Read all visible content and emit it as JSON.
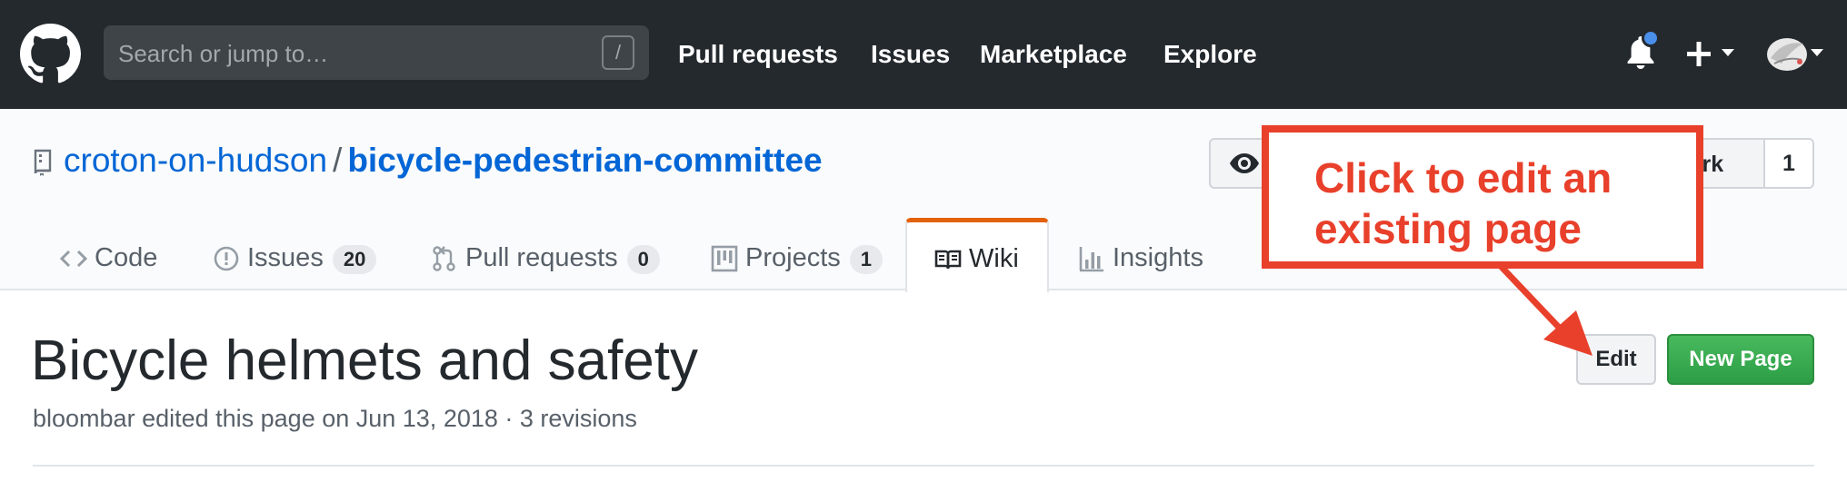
{
  "topbar": {
    "search_placeholder": "Search or jump to…",
    "search_shortcut": "/",
    "nav": [
      "Pull requests",
      "Issues",
      "Marketplace",
      "Explore"
    ]
  },
  "repo": {
    "owner": "croton-on-hudson",
    "separator": "/",
    "name": "bicycle-pedestrian-committee",
    "fork_label": "Fork",
    "fork_count": "1"
  },
  "tabs": {
    "code": {
      "label": "Code"
    },
    "issues": {
      "label": "Issues",
      "count": "20"
    },
    "pulls": {
      "label": "Pull requests",
      "count": "0"
    },
    "projects": {
      "label": "Projects",
      "count": "1"
    },
    "wiki": {
      "label": "Wiki"
    },
    "insights": {
      "label": "Insights"
    }
  },
  "wiki_page": {
    "title": "Bicycle helmets and safety",
    "meta": "bloombar edited this page on Jun 13, 2018 · 3 revisions",
    "edit_label": "Edit",
    "new_page_label": "New Page"
  },
  "annotation": {
    "text": "Click to edit an existing page",
    "color": "#e8402b"
  },
  "colors": {
    "header_bg": "#24292e",
    "link": "#0366d6",
    "green_button": "#2ea44f",
    "wiki_tab_accent": "#e36209"
  }
}
